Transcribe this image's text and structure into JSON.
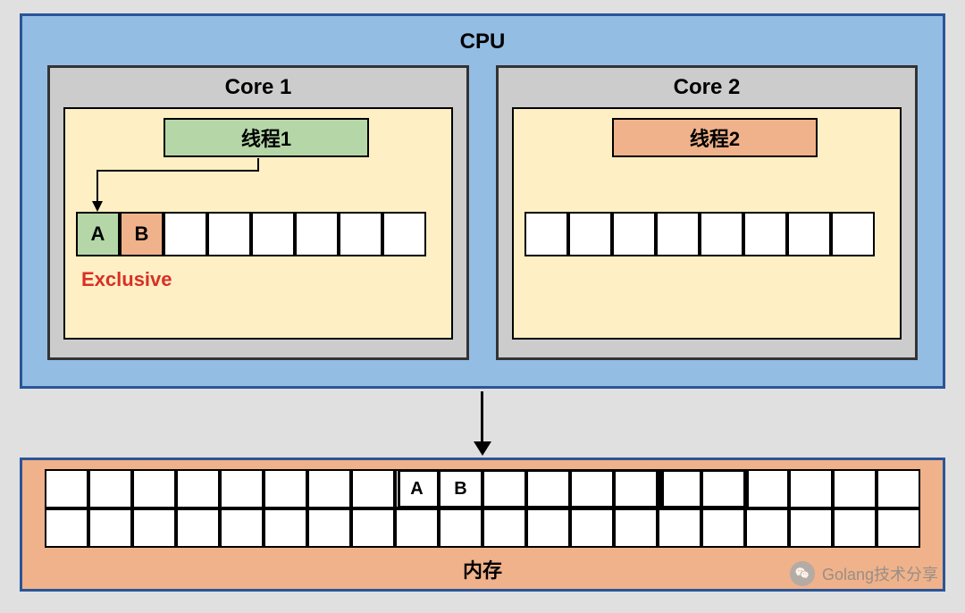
{
  "cpu": {
    "title": "CPU",
    "core1": {
      "title": "Core 1",
      "thread": "线程1",
      "cells": [
        "A",
        "B",
        "",
        "",
        "",
        "",
        "",
        ""
      ],
      "state": "Exclusive"
    },
    "core2": {
      "title": "Core 2",
      "thread": "线程2",
      "cells": [
        "",
        "",
        "",
        "",
        "",
        "",
        "",
        ""
      ]
    }
  },
  "memory": {
    "title": "内存",
    "row1": [
      "",
      "",
      "",
      "",
      "",
      "",
      "",
      "",
      "A",
      "B",
      "",
      "",
      "",
      "",
      "",
      "",
      "",
      "",
      "",
      ""
    ],
    "row2": [
      "",
      "",
      "",
      "",
      "",
      "",
      "",
      "",
      "",
      "",
      "",
      "",
      "",
      "",
      "",
      "",
      "",
      "",
      "",
      ""
    ]
  },
  "watermark": "Golang技术分享",
  "chart_data": {
    "type": "diagram",
    "description": "CPU cache coherency diagram illustrating MESI Exclusive state",
    "cpu": {
      "cores": [
        {
          "name": "Core 1",
          "thread": "线程1",
          "cache_line": [
            "A",
            "B",
            "",
            "",
            "",
            "",
            "",
            ""
          ],
          "mesi_state": "Exclusive",
          "owns_data": true
        },
        {
          "name": "Core 2",
          "thread": "线程2",
          "cache_line": [
            "",
            "",
            "",
            "",
            "",
            "",
            "",
            ""
          ],
          "mesi_state": null,
          "owns_data": false
        }
      ]
    },
    "main_memory": {
      "label": "内存",
      "rows": 2,
      "cols": 20,
      "data_blocks": [
        {
          "row": 0,
          "col": 8,
          "value": "A"
        },
        {
          "row": 0,
          "col": 9,
          "value": "B"
        }
      ],
      "highlighted_cache_lines_row0_col_ranges": [
        [
          8,
          15
        ],
        [
          14,
          15
        ]
      ]
    },
    "arrows": [
      {
        "from": "线程1",
        "to": "Core 1 cache cell A",
        "meaning": "thread reads/writes variable A into its core's cache line"
      },
      {
        "from": "CPU",
        "to": "内存",
        "meaning": "cache line loaded from main memory"
      }
    ],
    "watermark": "Golang技术分享"
  }
}
